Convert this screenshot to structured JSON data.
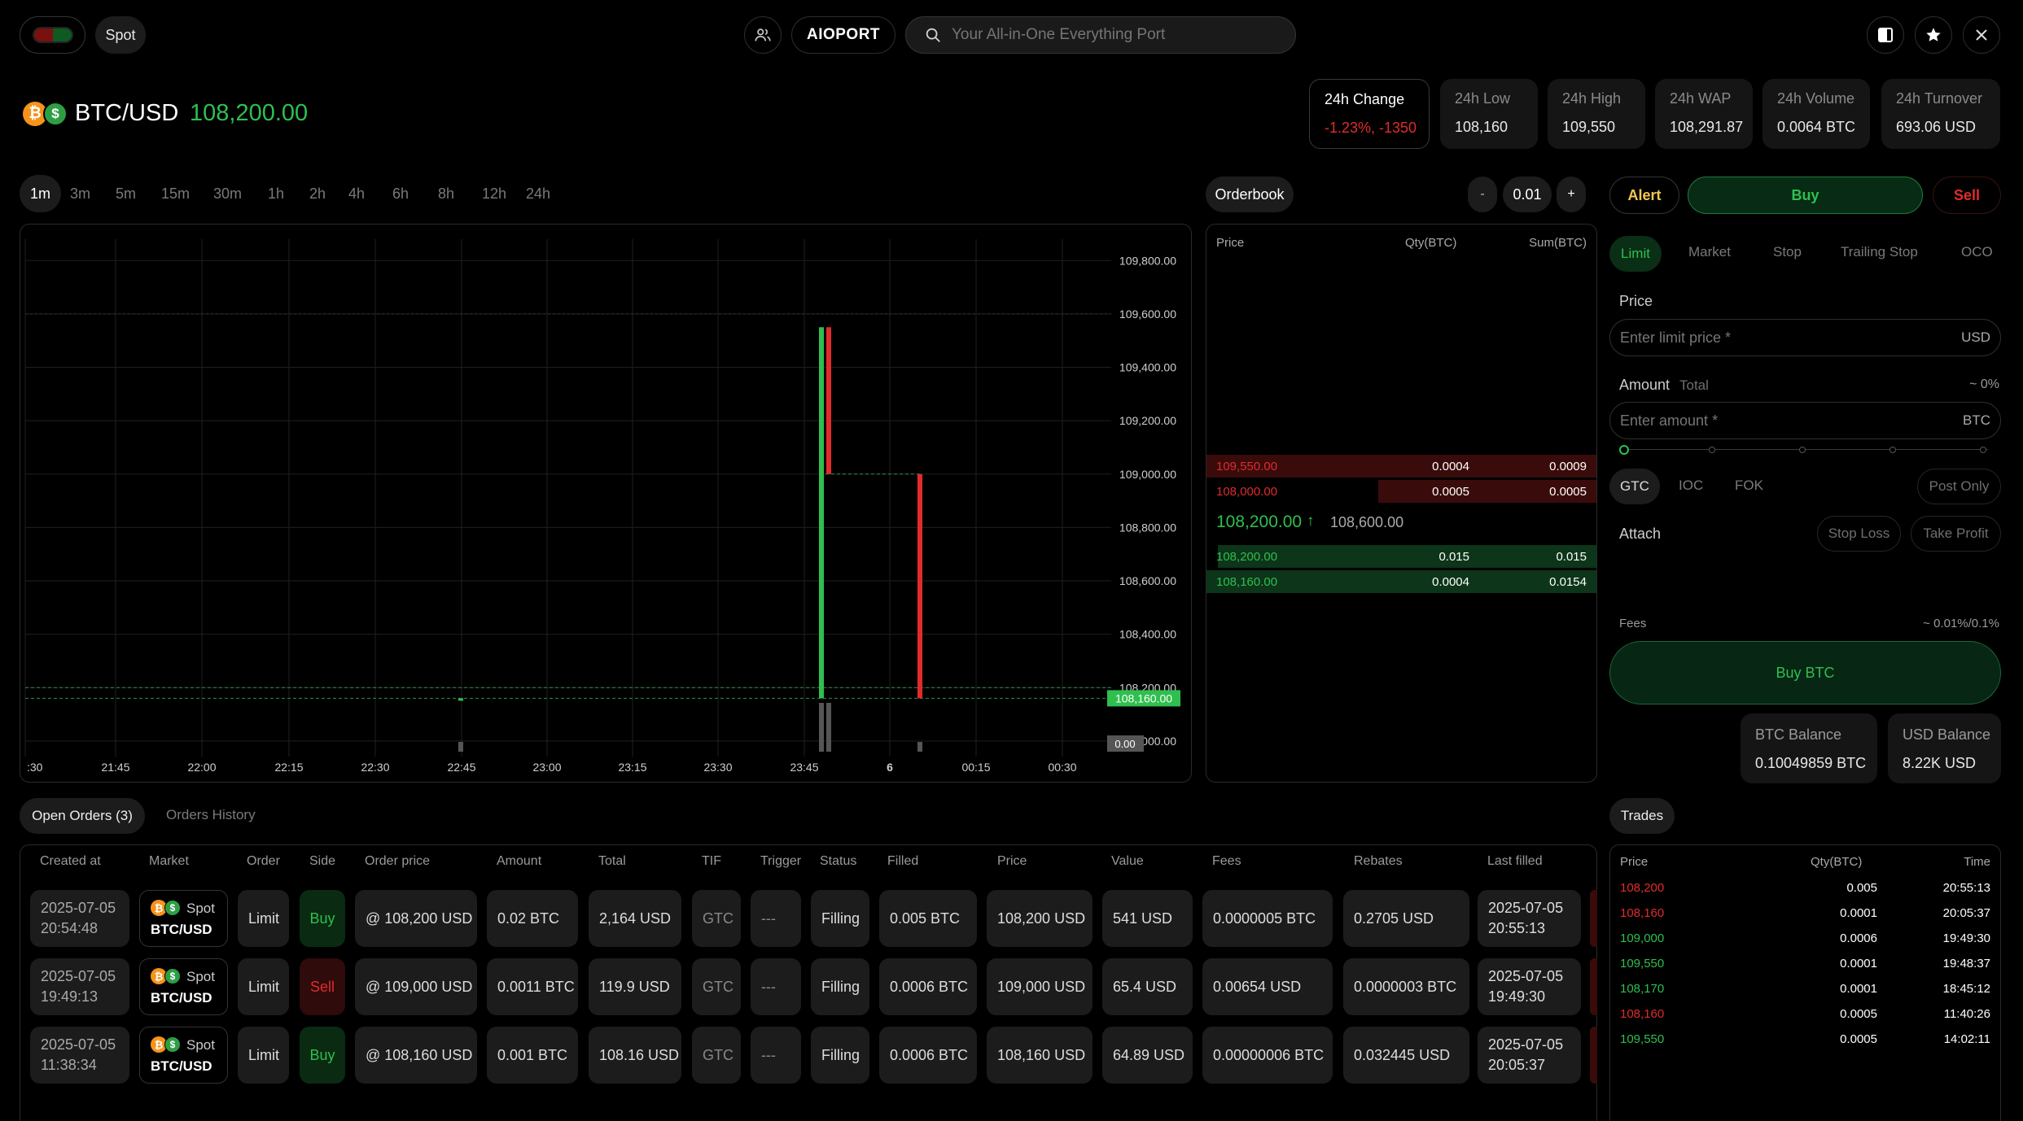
{
  "header": {
    "market_type": "Spot",
    "brand": "AIOPORT",
    "search_placeholder": "Your All-in-One Everything Port"
  },
  "ticker": {
    "symbol": "BTC/USD",
    "price": "108,200.00"
  },
  "stats": [
    {
      "label": "24h Change",
      "value": "-1.23%, -1350"
    },
    {
      "label": "24h Low",
      "value": "108,160"
    },
    {
      "label": "24h High",
      "value": "109,550"
    },
    {
      "label": "24h WAP",
      "value": "108,291.87"
    },
    {
      "label": "24h Volume",
      "value": "0.0064 BTC"
    },
    {
      "label": "24h Turnover",
      "value": "693.06 USD"
    }
  ],
  "timeframes": [
    "1m",
    "3m",
    "5m",
    "15m",
    "30m",
    "1h",
    "2h",
    "4h",
    "6h",
    "8h",
    "12h",
    "24h"
  ],
  "active_timeframe": "1m",
  "chart_data": {
    "type": "candlestick",
    "x_ticks": [
      ":30",
      "21:45",
      "22:00",
      "22:15",
      "22:30",
      "22:45",
      "23:00",
      "23:15",
      "23:30",
      "23:45",
      "6",
      "00:15",
      "00:30"
    ],
    "y_ticks": [
      "109,800.00",
      "109,600.00",
      "109,400.00",
      "109,200.00",
      "109,000.00",
      "108,800.00",
      "108,600.00",
      "108,400.00",
      "108,200.00",
      "108,000.00"
    ],
    "ylim": [
      107960,
      109880
    ],
    "price_label": "108,160.00",
    "volume_label": "0.00",
    "candles": [
      {
        "time": "22:45",
        "open": 108160,
        "high": 108160,
        "low": 108160,
        "close": 108160,
        "color": "#2fbf4f"
      },
      {
        "time": "23:51",
        "open": 108160,
        "high": 109550,
        "low": 108160,
        "close": 109550,
        "color": "#2fbf4f"
      },
      {
        "time": "23:52",
        "open": 109550,
        "high": 109550,
        "low": 109000,
        "close": 109000,
        "color": "#e12b2b"
      },
      {
        "time": "00:06",
        "open": 109000,
        "high": 109000,
        "low": 108160,
        "close": 108160,
        "color": "#e12b2b"
      }
    ],
    "levels": [
      108200,
      108160
    ]
  },
  "orderbook": {
    "title": "Orderbook",
    "step": "0.01",
    "minus": "-",
    "plus": "+",
    "headers": [
      "Price",
      "Qty(BTC)",
      "Sum(BTC)"
    ],
    "asks": [
      {
        "price": "109,550.00",
        "qty": "0.0004",
        "sum": "0.0009",
        "depth": 1.0
      },
      {
        "price": "108,000.00",
        "qty": "0.0005",
        "sum": "0.0005",
        "depth": 0.56
      }
    ],
    "mid_price": "108,200.00",
    "mid_arrow": "↑",
    "mark_price": "108,600.00",
    "bids": [
      {
        "price": "108,200.00",
        "qty": "0.015",
        "sum": "0.015",
        "depth": 0.97
      },
      {
        "price": "108,160.00",
        "qty": "0.0004",
        "sum": "0.0154",
        "depth": 1.0
      }
    ]
  },
  "order_form": {
    "alert": "Alert",
    "buy": "Buy",
    "sell": "Sell",
    "types": [
      "Limit",
      "Market",
      "Stop",
      "Trailing Stop",
      "OCO"
    ],
    "price_label": "Price",
    "price_placeholder": "Enter limit price *",
    "price_unit": "USD",
    "amount_label": "Amount",
    "total_label": "Total",
    "amount_pct": "~ 0%",
    "amount_placeholder": "Enter amount *",
    "amount_unit": "BTC",
    "tif": [
      "GTC",
      "IOC",
      "FOK"
    ],
    "post_only": "Post Only",
    "attach_label": "Attach",
    "stop_loss": "Stop Loss",
    "take_profit": "Take Profit",
    "fees_label": "Fees",
    "fees_value": "~ 0.01%/0.1%",
    "submit": "Buy BTC",
    "btc_balance_label": "BTC Balance",
    "btc_balance": "0.10049859 BTC",
    "usd_balance_label": "USD Balance",
    "usd_balance": "8.22K USD"
  },
  "orders": {
    "tab_open": "Open Orders (3)",
    "tab_history": "Orders History",
    "headers": [
      "Created at",
      "Market",
      "Order",
      "Side",
      "Order price",
      "Amount",
      "Total",
      "TIF",
      "Trigger",
      "Status",
      "Filled",
      "Price",
      "Value",
      "Fees",
      "Rebates",
      "Last filled"
    ],
    "rows": [
      {
        "date": "2025-07-05",
        "time": "20:54:48",
        "spot": "Spot",
        "market": "BTC/USD",
        "order": "Limit",
        "side": "Buy",
        "order_price": "@ 108,200 USD",
        "amount": "0.02 BTC",
        "total": "2,164 USD",
        "tif": "GTC",
        "trigger": "---",
        "status": "Filling",
        "filled": "0.005 BTC",
        "price": "108,200 USD",
        "value": "541 USD",
        "fees": "0.0000005 BTC",
        "rebates": "0.2705 USD",
        "last_date": "2025-07-05",
        "last_time": "20:55:13"
      },
      {
        "date": "2025-07-05",
        "time": "19:49:13",
        "spot": "Spot",
        "market": "BTC/USD",
        "order": "Limit",
        "side": "Sell",
        "order_price": "@ 109,000 USD",
        "amount": "0.0011 BTC",
        "total": "119.9 USD",
        "tif": "GTC",
        "trigger": "---",
        "status": "Filling",
        "filled": "0.0006 BTC",
        "price": "109,000 USD",
        "value": "65.4 USD",
        "fees": "0.00654 USD",
        "rebates": "0.0000003 BTC",
        "last_date": "2025-07-05",
        "last_time": "19:49:30"
      },
      {
        "date": "2025-07-05",
        "time": "11:38:34",
        "spot": "Spot",
        "market": "BTC/USD",
        "order": "Limit",
        "side": "Buy",
        "order_price": "@ 108,160 USD",
        "amount": "0.001 BTC",
        "total": "108.16 USD",
        "tif": "GTC",
        "trigger": "---",
        "status": "Filling",
        "filled": "0.0006 BTC",
        "price": "108,160 USD",
        "value": "64.89 USD",
        "fees": "0.00000006 BTC",
        "rebates": "0.032445 USD",
        "last_date": "2025-07-05",
        "last_time": "20:05:37"
      }
    ]
  },
  "trades": {
    "title": "Trades",
    "headers": [
      "Price",
      "Qty(BTC)",
      "Time"
    ],
    "rows": [
      {
        "price": "108,200",
        "qty": "0.005",
        "time": "20:55:13",
        "side": "sell"
      },
      {
        "price": "108,160",
        "qty": "0.0001",
        "time": "20:05:37",
        "side": "sell"
      },
      {
        "price": "109,000",
        "qty": "0.0006",
        "time": "19:49:30",
        "side": "buy"
      },
      {
        "price": "109,550",
        "qty": "0.0001",
        "time": "19:48:37",
        "side": "buy"
      },
      {
        "price": "108,170",
        "qty": "0.0001",
        "time": "18:45:12",
        "side": "buy"
      },
      {
        "price": "108,160",
        "qty": "0.0005",
        "time": "11:40:26",
        "side": "sell"
      },
      {
        "price": "109,550",
        "qty": "0.0005",
        "time": "14:02:11",
        "side": "buy"
      }
    ]
  },
  "colors": {
    "green": "#2fbf4f",
    "red": "#e12b2b",
    "bg": "#000000",
    "panel": "#151515",
    "btc": "#f7931a",
    "usd": "#2e9e44"
  }
}
